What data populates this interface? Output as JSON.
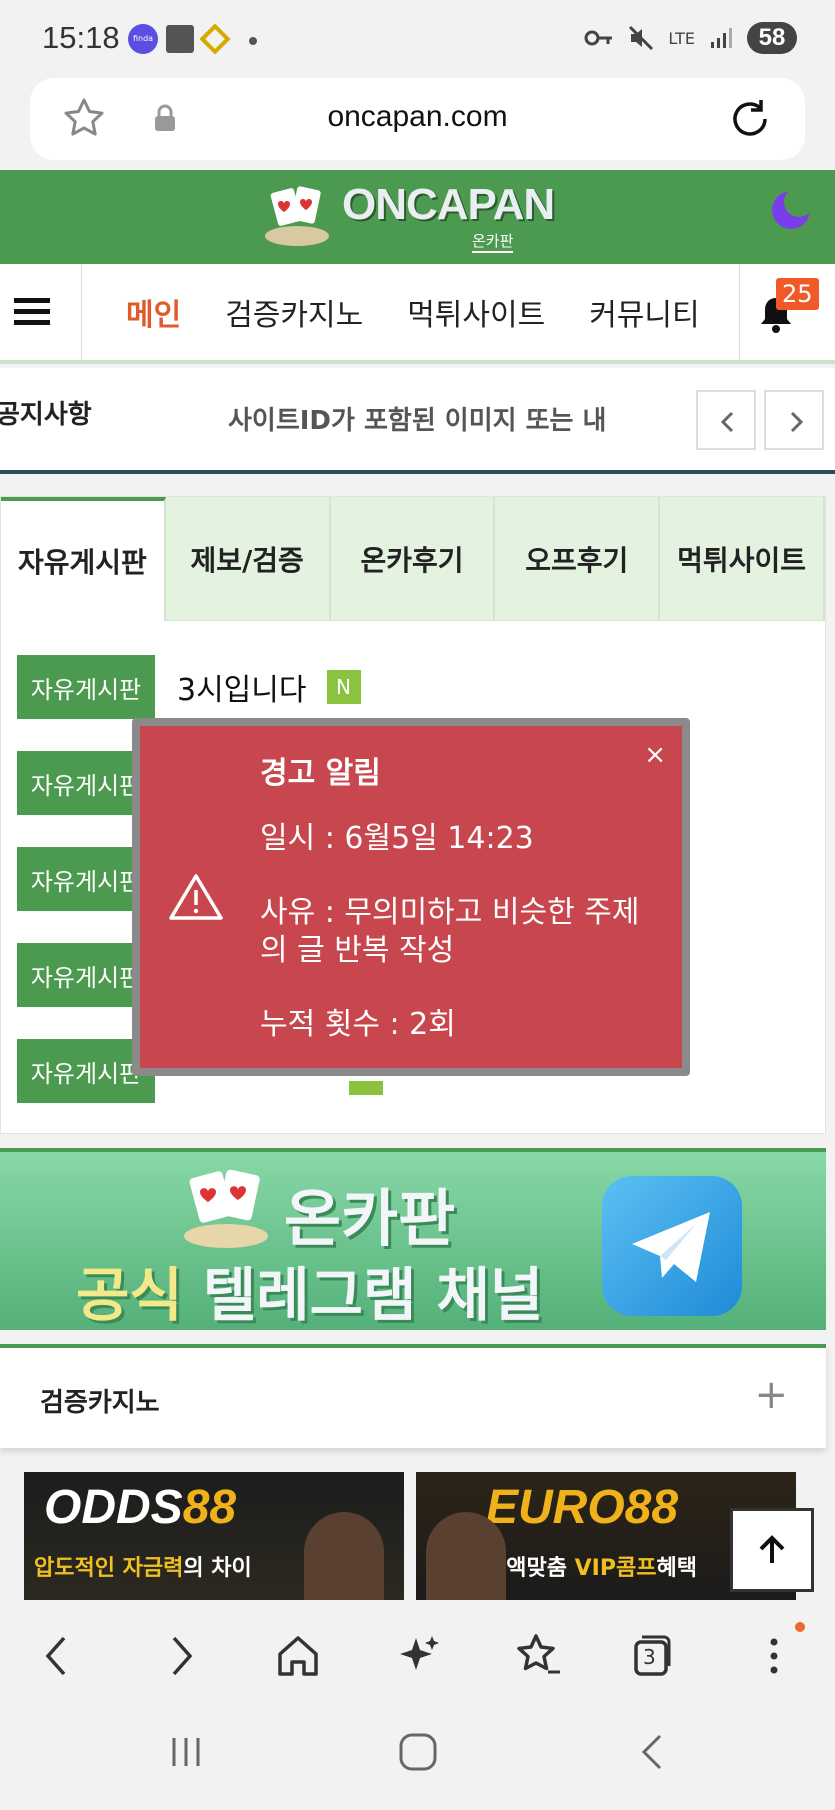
{
  "status_bar": {
    "time": "15:18",
    "finda_label": "finda",
    "network": "LTE",
    "battery": "58"
  },
  "browser": {
    "url": "oncapan.com"
  },
  "site": {
    "logo_text": "ONCAPAN",
    "logo_sub": "온카판",
    "brand_color": "#4c9a4f"
  },
  "nav": {
    "items": [
      "메인",
      "검증카지노",
      "먹튀사이트",
      "커뮤니티"
    ],
    "bell_count": "25"
  },
  "notice": {
    "label": "공지사항",
    "text": "사이트ID가 포함된 이미지 또는 내"
  },
  "board": {
    "tabs": [
      "자유게시판",
      "제보/검증",
      "온카후기",
      "오프후기",
      "먹튀사이트"
    ],
    "posts": [
      {
        "category": "자유게시판",
        "title": "3시입니다",
        "badge": "N"
      },
      {
        "category": "자유게시판",
        "title": "",
        "badge": ""
      },
      {
        "category": "자유게시판",
        "title": "",
        "badge": ""
      },
      {
        "category": "자유게시판",
        "title": "",
        "badge": ""
      },
      {
        "category": "자유게시판",
        "title": "",
        "badge": ""
      }
    ]
  },
  "modal": {
    "title": "경고 알림",
    "close": "×",
    "date": "일시 : 6월5일 14:23",
    "reason": "사유 : 무의미하고 비슷한 주제의 글 반복 작성",
    "count": "누적 횟수 : 2회",
    "color": "#c8474f"
  },
  "telegram_banner": {
    "line1": "온카판",
    "line2_highlight": "공식",
    "line2_rest": " 텔레그램 채널"
  },
  "section": {
    "title": "검증카지노",
    "plus": "+"
  },
  "ads": [
    {
      "brand": "ODDS88",
      "brand_main": "ODDS",
      "brand_num": "88",
      "tag_y": "압도적인 자금력",
      "tag_w": "의 차이"
    },
    {
      "brand": "EURO88",
      "tag_w": "긴액맞춤 ",
      "tag_y": "VIP콤프",
      "tag_w2": "혜택"
    }
  ],
  "toolbar": {
    "tabs_count": "3"
  }
}
